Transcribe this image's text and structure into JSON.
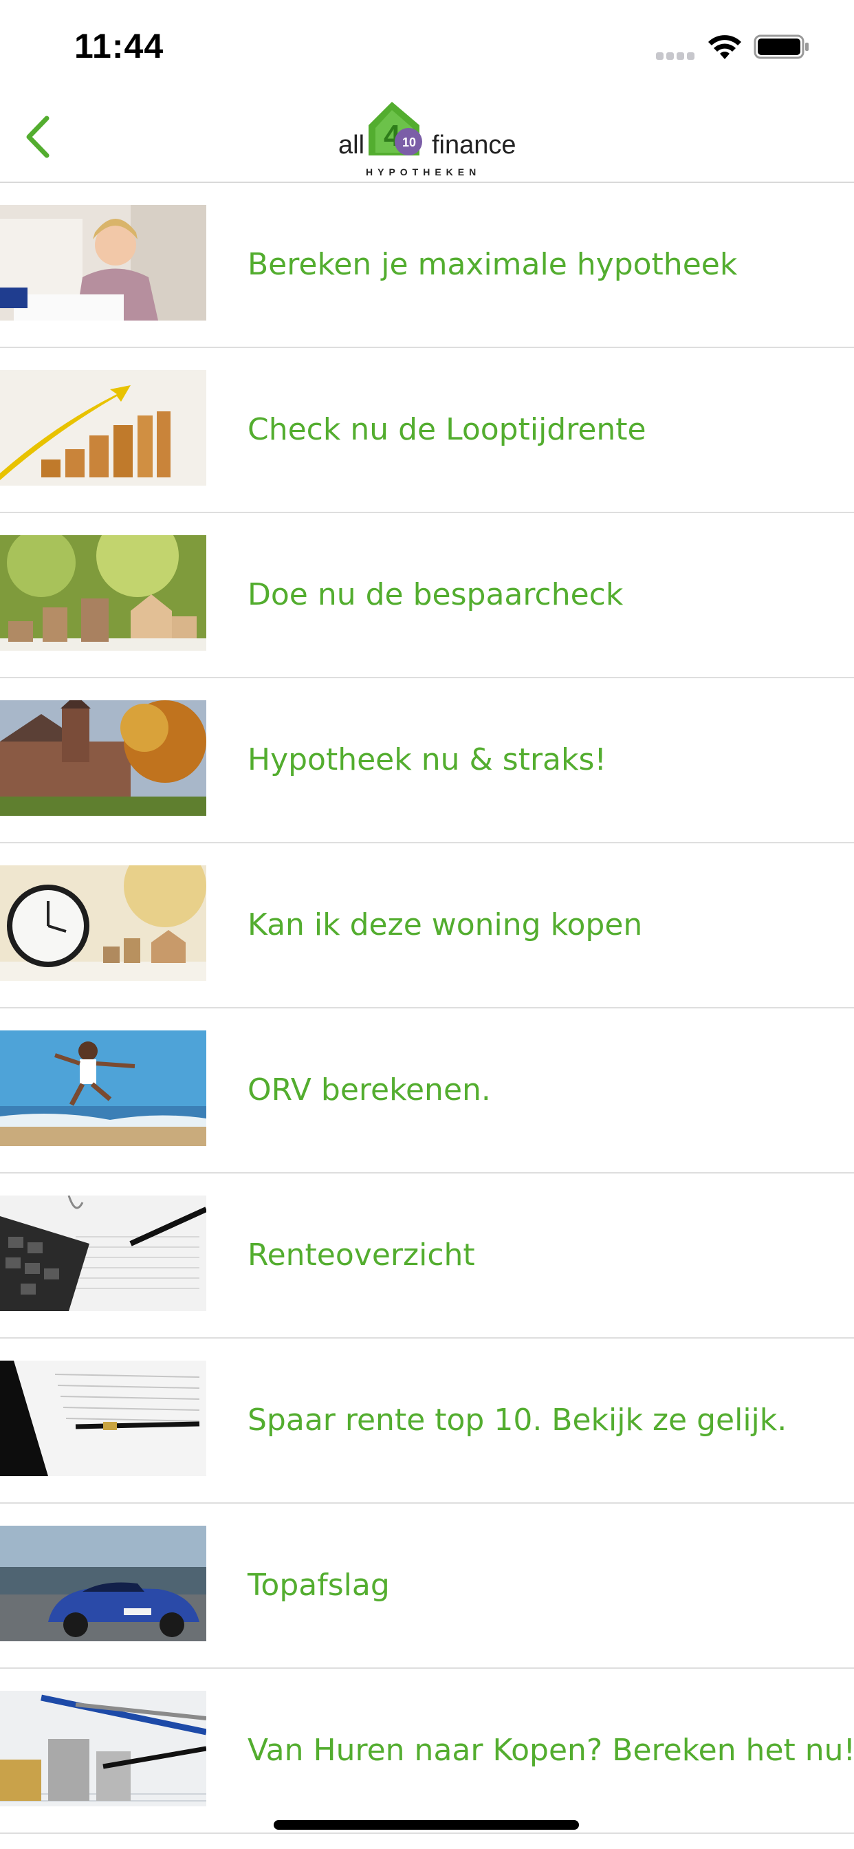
{
  "status_bar": {
    "time": "11:44",
    "icons": [
      "signal-icon",
      "wifi-icon",
      "battery-icon"
    ]
  },
  "nav": {
    "back_icon": "chevron-left-icon",
    "logo": {
      "left": "all",
      "right": "finance",
      "badge": "10",
      "sub": "HYPOTHEKEN"
    }
  },
  "colors": {
    "accent": "#53ad2f",
    "divider": "#dedede"
  },
  "items": [
    {
      "label": "Bereken je maximale hypotheek",
      "image": "woman-calculating-photo"
    },
    {
      "label": "Check nu de Looptijdrente",
      "image": "growth-chart-blocks-photo"
    },
    {
      "label": "Doe nu de bespaarcheck",
      "image": "coins-and-house-photo"
    },
    {
      "label": "Hypotheek nu & straks!",
      "image": "castle-photo"
    },
    {
      "label": "Kan ik deze woning kopen",
      "image": "clock-and-coins-photo"
    },
    {
      "label": "ORV berekenen.",
      "image": "woman-jumping-beach-photo"
    },
    {
      "label": "Renteoverzicht",
      "image": "calculator-and-pen-photo"
    },
    {
      "label": "Spaar rente top 10. Bekijk ze gelijk.",
      "image": "pen-on-document-photo"
    },
    {
      "label": "Topafslag",
      "image": "blue-sports-car-photo"
    },
    {
      "label": "Van Huren naar Kopen? Bereken het nu!",
      "image": "coins-and-pens-photo"
    }
  ]
}
